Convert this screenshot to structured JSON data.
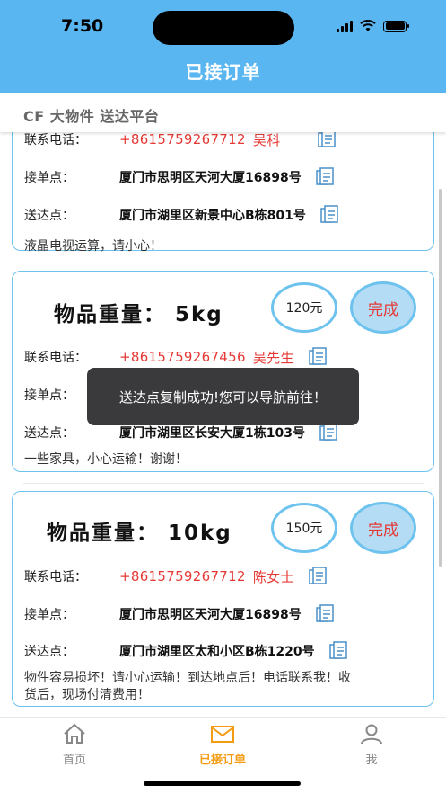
{
  "status_bar": {
    "time": "7:50"
  },
  "header": {
    "title": "已接订单"
  },
  "subheader": {
    "text": "CF 大物件 送达平台"
  },
  "labels": {
    "phone": "联系电话：",
    "pickup": "接单点：",
    "dropoff": "送达点：",
    "done": "完成"
  },
  "orders": [
    {
      "phone": "+8615759267712",
      "contact": "吴科",
      "pickup": "厦门市思明区天河大厦16898号",
      "dropoff": "厦门市湖里区新景中心B栋801号",
      "note": "液晶电视运算，请小心！"
    },
    {
      "weight": "物品重量： 5kg",
      "price": "120元",
      "phone": "+8615759267456",
      "contact": "吴先生",
      "pickup": "",
      "dropoff": "厦门市湖里区长安大厦1栋103号",
      "note": "一些家具，小心运输！谢谢！"
    },
    {
      "weight": "物品重量： 10kg",
      "price": "150元",
      "phone": "+8615759267712",
      "contact": "陈女士",
      "pickup": "厦门市思明区天河大厦16898号",
      "dropoff": "厦门市湖里区太和小区B栋1220号",
      "note_line1": "物件容易损坏！请小心运输！到达地点后！电话联系我！收",
      "note_line2": "货后，现场付清费用！"
    }
  ],
  "toast": {
    "text": "送达点复制成功!您可以导航前往！"
  },
  "tabbar": {
    "tabs": [
      {
        "label": "首页",
        "icon": "home-icon"
      },
      {
        "label": "已接订单",
        "icon": "mail-icon"
      },
      {
        "label": "我",
        "icon": "person-icon"
      }
    ]
  },
  "colors": {
    "accent": "#5ab6f0",
    "active_tab": "#f39c12",
    "phone": "#e53935"
  }
}
